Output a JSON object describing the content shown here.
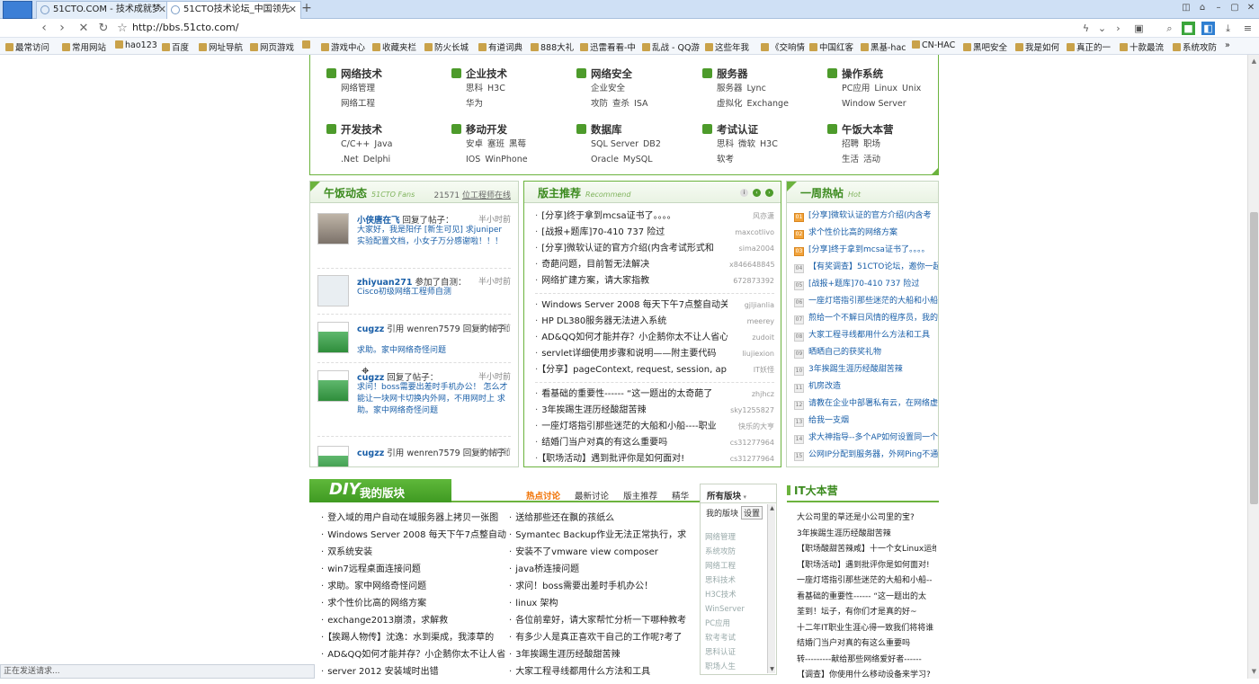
{
  "browser": {
    "tabs": [
      {
        "title": "51CTO.COM - 技术成就梦",
        "active": false
      },
      {
        "title": "51CTO技术论坛_中国领先",
        "active": true
      }
    ],
    "new_tab": "+",
    "url": "http://bbs.51cto.com/",
    "status_text": "正在发送请求..."
  },
  "bookmarks": [
    "最常访问",
    "常用网站",
    "hao123",
    "百度",
    "网址导航",
    "网页游戏",
    "",
    "游戏中心",
    "收藏夹栏",
    "防火长城",
    "有道词典",
    "888大礼",
    "迅雷看看-中",
    "乱战 - QQ游",
    "这些年我",
    "《交响情",
    "中国红客",
    "黑基-hac",
    "CN-HAC",
    "黑吧安全",
    "我是如何",
    "真正的一",
    "十款最流",
    "系统攻防"
  ],
  "categories": [
    {
      "title": "网络技术",
      "links": [
        [
          "网络管理"
        ],
        [
          "网络工程"
        ]
      ]
    },
    {
      "title": "企业技术",
      "links": [
        [
          "思科",
          "H3C"
        ],
        [
          "华为"
        ]
      ]
    },
    {
      "title": "网络安全",
      "links": [
        [
          "企业安全"
        ],
        [
          "攻防",
          "查杀",
          "ISA"
        ]
      ]
    },
    {
      "title": "服务器",
      "links": [
        [
          "服务器",
          "Lync"
        ],
        [
          "虚拟化",
          "Exchange"
        ]
      ]
    },
    {
      "title": "操作系统",
      "links": [
        [
          "PC应用",
          "Linux",
          "Unix"
        ],
        [
          "Window Server"
        ]
      ]
    },
    {
      "title": "开发技术",
      "links": [
        [
          "C/C++",
          "Java"
        ],
        [
          ".Net",
          "Delphi"
        ]
      ]
    },
    {
      "title": "移动开发",
      "links": [
        [
          "安卓",
          "塞班",
          "黑莓"
        ],
        [
          "IOS",
          "WinPhone"
        ]
      ]
    },
    {
      "title": "数据库",
      "links": [
        [
          "SQL Server",
          "DB2"
        ],
        [
          "Oracle",
          "MySQL"
        ]
      ]
    },
    {
      "title": "考试认证",
      "links": [
        [
          "思科",
          "微软",
          "H3C"
        ],
        [
          "软考"
        ]
      ]
    },
    {
      "title": "午饭大本营",
      "links": [
        [
          "招聘",
          "职场"
        ],
        [
          "生活",
          "活动"
        ]
      ]
    }
  ],
  "activity": {
    "title": "午饭动态",
    "title_en": "51CTO Fans",
    "count": "21571",
    "count_label": "位工程师在线",
    "items": [
      {
        "user": "小侠唐在飞",
        "action": "回复了帖子：",
        "time": "半小时前",
        "text": "大家好，我是阳仔 [新生可见] 求juniper 实验配置文档，小女子万分感谢啦！！！",
        "avatar": "photo"
      },
      {
        "user": "zhiyuan271",
        "action": "参加了自测：",
        "time": "半小时前",
        "text": "Cisco初级网络工程师自测",
        "avatar": "blank"
      },
      {
        "user": "cugzz",
        "action": "引用 wenren7579 回复的帖子：",
        "time": "半小时前",
        "text": "求助。家中网络奇怪问题",
        "avatar": "green"
      },
      {
        "user": "cugzz",
        "action": "回复了帖子：",
        "time": "半小时前",
        "text": "求问！boss需要出差时手机办公！ 怎么才能让一块网卡切换内外网，不用网时上 求助。家中网络奇怪问题",
        "avatar": "green"
      },
      {
        "user": "cugzz",
        "action": "引用 wenren7579 回复的帖子：",
        "time": "半小时前",
        "text": "",
        "avatar": "green"
      }
    ]
  },
  "moderator": {
    "title": "版主推荐",
    "title_en": "Recommend",
    "groups": [
      [
        {
          "title": "[分享]终于拿到mcsa证书了。。。。",
          "author": "风亦潇"
        },
        {
          "title": "[战报+题库]70-410 737 险过",
          "author": "maxcotlivo"
        },
        {
          "title": "[分享]微软认证的官方介绍(内含考试形式和",
          "author": "sima2004"
        },
        {
          "title": "奇葩问题，目前暂无法解决",
          "author": "x846648845"
        },
        {
          "title": "网络扩建方案，请大家指教",
          "author": "672873392"
        }
      ],
      [
        {
          "title": "Windows Server 2008 每天下午7点整自动关机",
          "author": "gjljianlia"
        },
        {
          "title": "HP DL380服务器无法进入系统",
          "author": "meerey"
        },
        {
          "title": "AD&QQ如何才能并存？小企鹅你太不让人省心了",
          "author": "zudoit"
        },
        {
          "title": "servlet详细使用步骤和说明——附主要代码",
          "author": "liujiexion"
        },
        {
          "title": "【分享】pageContext, request, session, ap",
          "author": "IT妖怪"
        }
      ],
      [
        {
          "title": "看基础的重要性------ “这一题出的太奇葩了",
          "author": "zhjhcz"
        },
        {
          "title": "3年挨踢生涯历经酸甜苦辣",
          "author": "sky1255827"
        },
        {
          "title": "一座灯塔指引那些迷茫的大船和小船----职业",
          "author": "快乐的大亨"
        },
        {
          "title": "结婚门当户对真的有这么重要吗",
          "author": "cs31277964"
        },
        {
          "title": "【职场活动】遇到批评你是如何面对!",
          "author": "cs31277964"
        }
      ]
    ]
  },
  "hot_week": {
    "title": "一周热帖",
    "title_en": "Hot",
    "items": [
      "[分享]微软认证的官方介绍(内含考",
      "求个性价比高的网络方案",
      "[分享]终于拿到mcsa证书了。。。。",
      "【有奖调查】51CTO论坛，邀你一起",
      "[战报+题库]70-410 737 险过",
      "一座灯塔指引那些迷茫的大船和小船",
      "煎给一个不解日风情的程序员，我的",
      "大家工程寻线都用什么方法和工具",
      "晒晒自己的获奖礼物",
      "3年挨踢生涯历经酸甜苦辣",
      "机房改造",
      "请教在企业中部署私有云，在网络虚",
      "给我一支烟",
      "求大神指导--多个AP如何设置同一个",
      "公网IP分配到服务器，外网Ping不通"
    ],
    "badges": [
      "01",
      "02",
      "03",
      "04",
      "05",
      "06",
      "07",
      "08",
      "09",
      "10",
      "11",
      "12",
      "13",
      "14",
      "15"
    ]
  },
  "diy": {
    "logo": "DIY",
    "title": "我的版块",
    "tabs": [
      "热点讨论",
      "最新讨论",
      "版主推荐",
      "精华"
    ],
    "all_label": "所有版块",
    "panel_head": "我的版块",
    "panel_set": "设置",
    "panel_items": [
      "网络管理",
      "系统攻防",
      "网络工程",
      "思科技术",
      "H3C技术",
      "WinServer",
      "PC应用",
      "软考考试",
      "思科认证",
      "职场人生"
    ],
    "left": [
      "登入域的用户自动在域服务器上拷贝一张图",
      "Windows Server 2008 每天下午7点整自动",
      "双系统安装",
      "win7远程桌面连接问题",
      "求助。家中网络奇怪问题",
      "求个性价比高的网络方案",
      "exchange2013崩溃，求解救",
      "【挨踢人物传】沈逸：水到渠成，我漆草的",
      "AD&QQ如何才能并存？小企鹅你太不让人省",
      "server 2012 安装域时出错"
    ],
    "right": [
      "送给那些还在飘的孩纸么",
      "Symantec Backup作业无法正常执行，求",
      "安装不了vmware view composer",
      "java桥连接问题",
      "求问！boss需要出差时手机办公！",
      "linux 架构",
      "各位前辈好，请大家帮忙分析一下哪种教考",
      "有多少人是真正喜欢干自己的工作呢?考了",
      "3年挨踢生涯历经酸甜苦辣",
      "大家工程寻线都用什么方法和工具"
    ]
  },
  "it_camp": {
    "title": "IT大本营",
    "items": [
      "大公司里的草还是小公司里的宝?",
      "3年挨踢生涯历经酸甜苦辣",
      "【职场酸甜苦辣咸】十一个女Linux运维",
      "【职场活动】遇到批评你是如何面对!",
      "一座灯塔指引那些迷茫的大船和小船--",
      "看基础的重要性------ “这一题出的太",
      "荃到！坛子，有你们才是真的好~",
      "十二年IT职业生涯心得一致我们将将谁",
      "结婚门当户对真的有这么重要吗",
      "转---------献给那些网络爱好者------",
      "【调查】你使用什么移动设备来学习?"
    ]
  }
}
